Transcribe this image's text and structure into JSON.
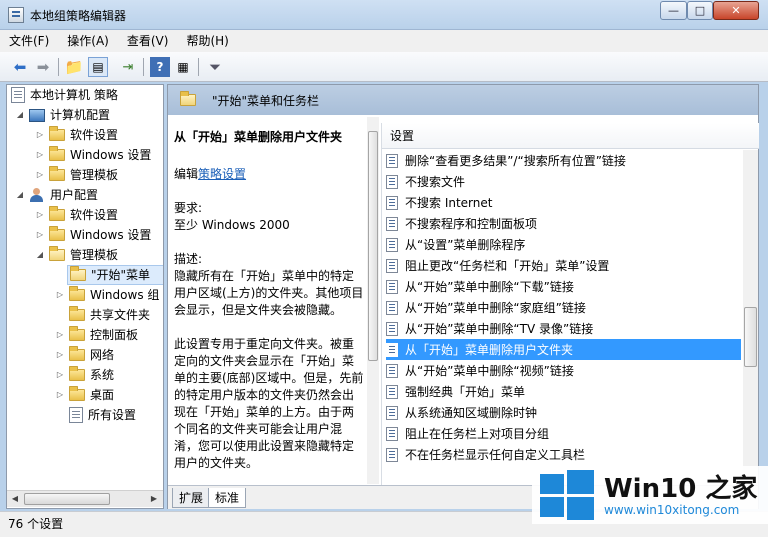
{
  "window": {
    "title": "本地组策略编辑器",
    "min": "—",
    "max": "□",
    "close": "✕"
  },
  "menu": [
    "文件(F)",
    "操作(A)",
    "查看(V)",
    "帮助(H)"
  ],
  "tree": {
    "root": "本地计算机 策略",
    "computer_config": "计算机配置",
    "comp_children": [
      "软件设置",
      "Windows 设置",
      "管理模板"
    ],
    "user_config": "用户配置",
    "user_children": [
      "软件设置",
      "Windows 设置",
      "管理模板"
    ],
    "admin_children": [
      "\"开始\"菜单",
      "Windows 组",
      "共享文件夹",
      "控制面板",
      "网络",
      "系统",
      "桌面",
      "所有设置"
    ]
  },
  "header": {
    "title": "\"开始\"菜单和任务栏"
  },
  "description": {
    "title": "从「开始」菜单删除用户文件夹",
    "edit_prefix": "编辑",
    "edit_link": "策略设置",
    "req_label": "要求:",
    "req_value": "至少 Windows 2000",
    "desc_label": "描述:",
    "desc_p1": "隐藏所有在「开始」菜单中的特定用户区域(上方)的文件夹。其他项目会显示，但是文件夹会被隐藏。",
    "desc_p2": "此设置专用于重定向文件夹。被重定向的文件夹会显示在「开始」菜单的主要(底部)区域中。但是，先前的特定用户版本的文件夹仍然会出现在「开始」菜单的上方。由于两个同名的文件夹可能会让用户混淆，您可以使用此设置来隐藏特定用户的文件夹。"
  },
  "list": {
    "header": "设置",
    "rows": [
      "删除“查看更多结果”/“搜索所有位置”链接",
      "不搜索文件",
      "不搜索 Internet",
      "不搜索程序和控制面板项",
      "从“设置”菜单删除程序",
      "阻止更改“任务栏和「开始」菜单”设置",
      "从“开始”菜单中删除“下载”链接",
      "从“开始”菜单中删除“家庭组”链接",
      "从“开始”菜单中删除“TV 录像”链接",
      "从「开始」菜单删除用户文件夹",
      "从“开始”菜单中删除“视频”链接",
      "强制经典「开始」菜单",
      "从系统通知区域删除时钟",
      "阻止在任务栏上对项目分组",
      "不在任务栏显示任何自定义工具栏"
    ],
    "selected_index": 9
  },
  "tabs": [
    "扩展",
    "标准"
  ],
  "status": "76 个设置",
  "watermark": {
    "title": "Win10 之家",
    "url": "www.win10xitong.com"
  },
  "colors": {
    "selection": "#3399ff",
    "header_band": "#a8bed8",
    "link": "#1b5fb8"
  }
}
